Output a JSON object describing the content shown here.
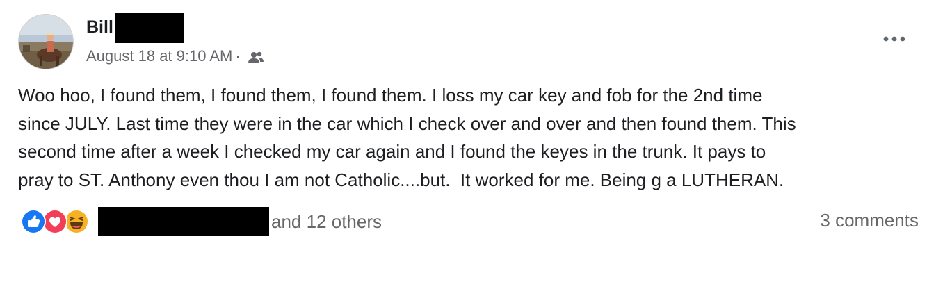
{
  "post": {
    "author_name": "Bill",
    "timestamp": "August 18 at 9:10 AM",
    "separator": "·",
    "audience_icon": "friends-icon",
    "more_icon": "more-options-icon",
    "text": "Woo hoo, I found them, I found them, I found them. I loss my car key and fob for the 2nd time\nsince JULY. Last time they were in the car which I check over and over and then found them. This\nsecond time after a week I checked my car again and I found the keyes in the trunk. It pays to\npray to ST. Anthony even thou I am not Catholic....but.  It worked for me. Being g a LUTHERAN."
  },
  "reactions": {
    "icons": [
      "like-icon",
      "love-icon",
      "haha-icon"
    ],
    "others_text": "and 12 others",
    "comments_text": "3 comments"
  },
  "colors": {
    "like": "#1877f2",
    "love": "#f33e58",
    "haha": "#f7b125",
    "secondary_text": "#65676b",
    "primary_text": "#1c1e21"
  }
}
